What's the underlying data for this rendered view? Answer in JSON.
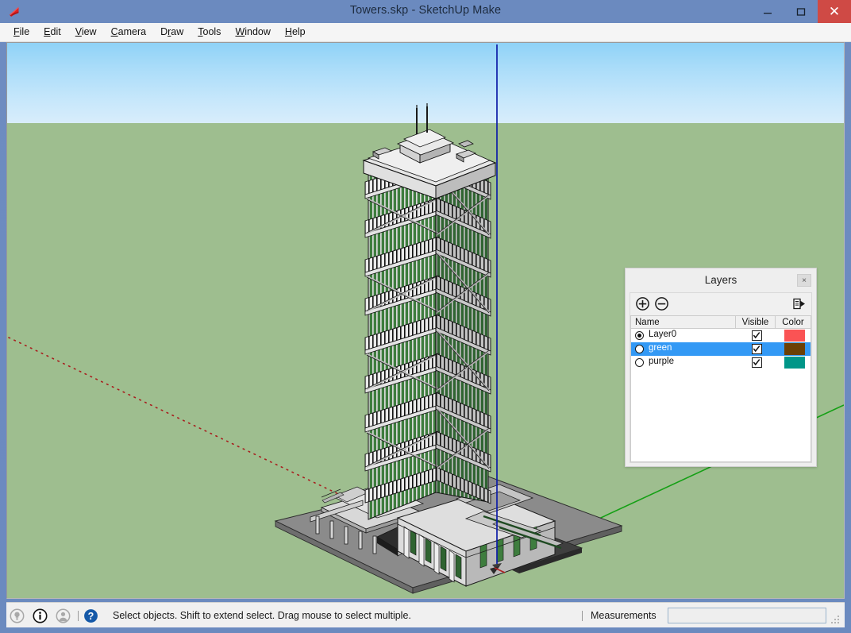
{
  "window": {
    "title": "Towers.skp - SketchUp Make",
    "app_icon": "sketchup-logo-icon",
    "minimize_label": "–",
    "maximize_label": "□",
    "close_label": "✕"
  },
  "menubar": {
    "items": [
      {
        "label": "File",
        "accel": "F",
        "accel_index": 0
      },
      {
        "label": "Edit",
        "accel": "E",
        "accel_index": 0
      },
      {
        "label": "View",
        "accel": "V",
        "accel_index": 0
      },
      {
        "label": "Camera",
        "accel": "C",
        "accel_index": 0
      },
      {
        "label": "Draw",
        "accel": "r",
        "accel_index": 1
      },
      {
        "label": "Tools",
        "accel": "T",
        "accel_index": 0
      },
      {
        "label": "Window",
        "accel": "W",
        "accel_index": 0
      },
      {
        "label": "Help",
        "accel": "H",
        "accel_index": 0
      }
    ]
  },
  "viewport": {
    "scene_description": "3D isometric view of a tall green-glass tower with antenna masts on a low-rise podium and gray plaza slab",
    "sky_color_top": "#8FD2F7",
    "sky_color_horizon": "#D8EDFB",
    "ground_color": "#9EBE8F",
    "axes": {
      "red_axis_color": "#B02020",
      "green_axis_color": "#12A012",
      "blue_axis_color": "#0C1CA8"
    },
    "model_colors": {
      "glass_green": "#3C7A3C",
      "glass_green_dark": "#2E6330",
      "concrete_light": "#E8E8E8",
      "concrete_mid": "#C9C9C9",
      "concrete_shade": "#A8A8A8",
      "plaza_gray": "#888888",
      "plaza_gray_dark": "#6E6E6E",
      "outline": "#000000"
    }
  },
  "layers_panel": {
    "title": "Layers",
    "close_label": "×",
    "add_icon": "plus-circle-icon",
    "delete_icon": "minus-circle-icon",
    "details_icon": "details-flyout-icon",
    "columns": [
      "Name",
      "Visible",
      "Color"
    ],
    "rows": [
      {
        "name": "Layer0",
        "active": true,
        "visible": true,
        "color": "#FA5354",
        "selected": false
      },
      {
        "name": "green",
        "active": false,
        "visible": true,
        "color": "#6B4005",
        "selected": true
      },
      {
        "name": "purple",
        "active": false,
        "visible": true,
        "color": "#009688",
        "selected": false
      }
    ]
  },
  "statusbar": {
    "icons": [
      {
        "name": "hint-bulb-icon",
        "glyph": "bulb"
      },
      {
        "name": "info-icon",
        "glyph": "info"
      },
      {
        "name": "account-icon",
        "glyph": "person"
      },
      {
        "name": "help-icon",
        "glyph": "question"
      }
    ],
    "status_text": "Select objects. Shift to extend select. Drag mouse to select multiple.",
    "measurements_label": "Measurements",
    "measurements_value": "",
    "measurements_placeholder": "",
    "resize_grip": "resize-grip-icon"
  }
}
